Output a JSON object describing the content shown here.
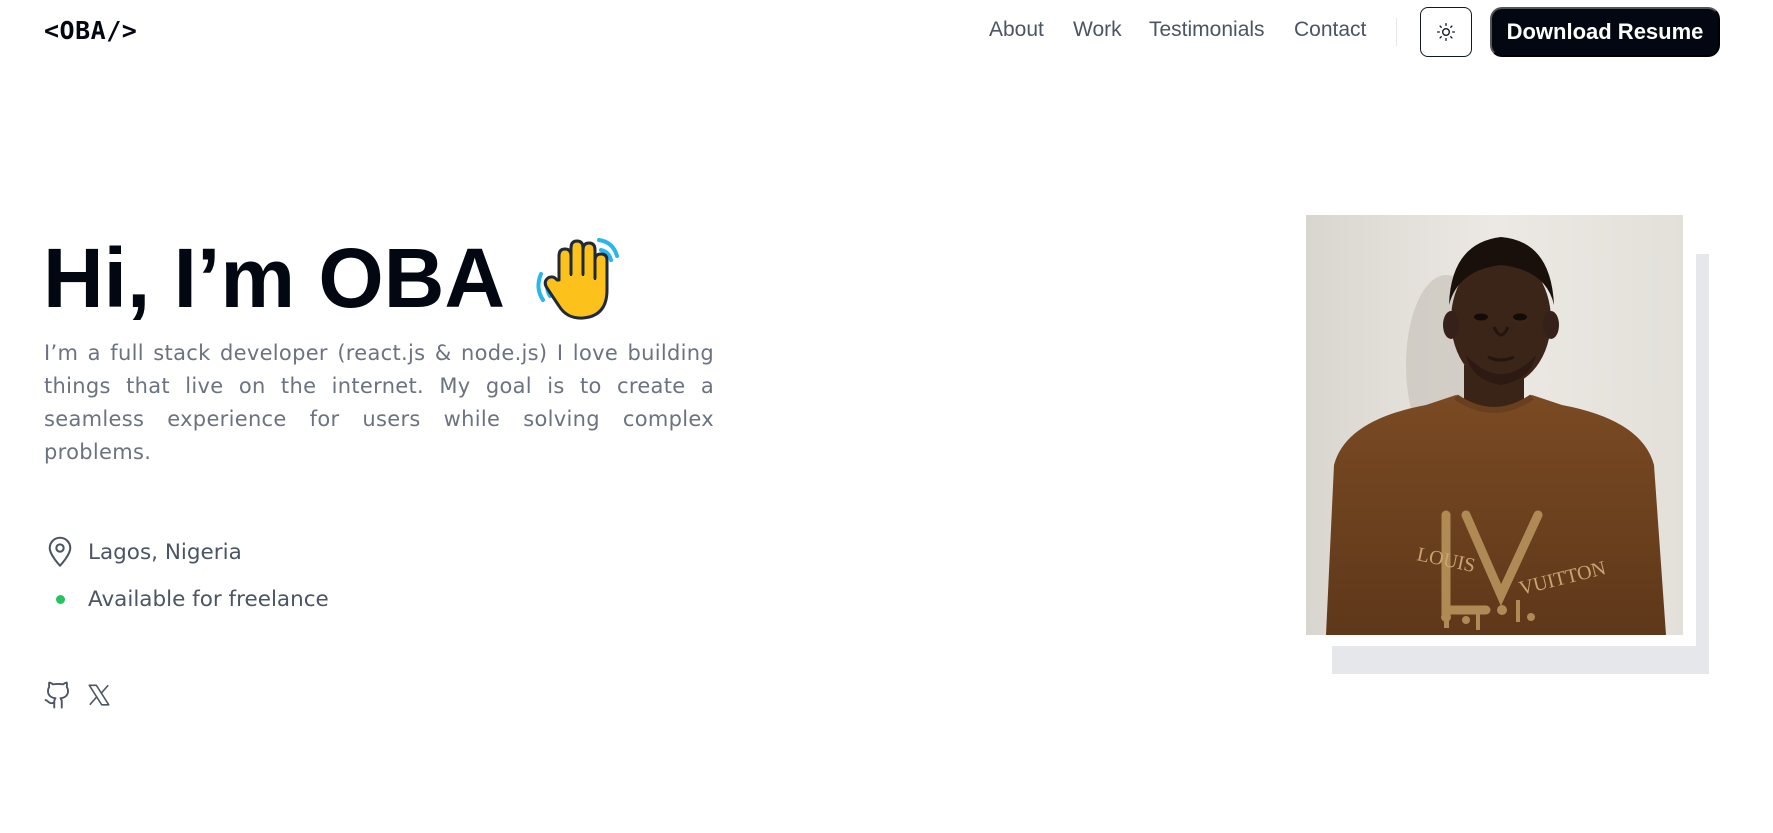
{
  "header": {
    "logo": "<OBA/>",
    "nav": [
      {
        "label": "About"
      },
      {
        "label": "Work"
      },
      {
        "label": "Testimonials"
      },
      {
        "label": "Contact"
      }
    ],
    "theme_toggle_icon": "sun-icon",
    "resume_button": "Download Resume"
  },
  "hero": {
    "title": "Hi, I’m OBA",
    "wave_icon": "waving-hand-icon",
    "description": "I’m a full stack developer (react.js & node.js) I love building things that live on the internet. My goal is to create a seamless experience for users while solving complex problems.",
    "location": "Lagos, Nigeria",
    "availability": "Available for freelance",
    "socials": [
      {
        "icon": "github-icon"
      },
      {
        "icon": "x-twitter-icon"
      }
    ],
    "photo_tshirt_text_1": "LOUIS",
    "photo_tshirt_text_2": "VUITTON"
  },
  "colors": {
    "primary": "#030712",
    "muted_text": "#6b7280",
    "nav_text": "#4b5563",
    "available_dot": "#22c55e",
    "photo_shadow": "#e5e7eb"
  }
}
